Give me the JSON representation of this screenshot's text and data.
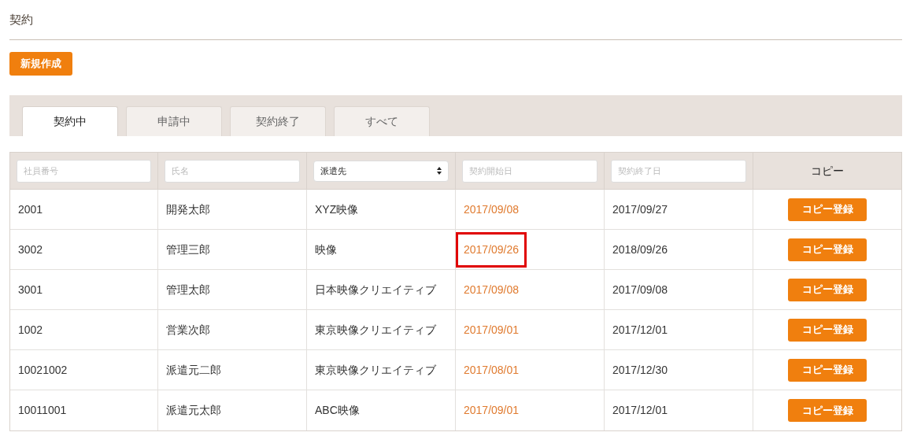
{
  "page_title": "契約",
  "new_button": "新規作成",
  "tabs": [
    {
      "label": "契約中",
      "selected": true
    },
    {
      "label": "申請中",
      "selected": false
    },
    {
      "label": "契約終了",
      "selected": false
    },
    {
      "label": "すべて",
      "selected": false
    }
  ],
  "filters": [
    {
      "kind": "input",
      "placeholder": "社員番号"
    },
    {
      "kind": "input",
      "placeholder": "氏名"
    },
    {
      "kind": "select",
      "value": "派遣先"
    },
    {
      "kind": "input",
      "placeholder": "契約開始日"
    },
    {
      "kind": "input",
      "placeholder": "契約終了日"
    },
    {
      "kind": "heading",
      "label": "コピー"
    }
  ],
  "rows": [
    {
      "id": "2001",
      "name": "開発太郎",
      "client": "XYZ映像",
      "start": "2017/09/08",
      "end": "2017/09/27",
      "action": "コピー登録",
      "highlighted": false
    },
    {
      "id": "3002",
      "name": "管理三郎",
      "client": "映像",
      "start": "2017/09/26",
      "end": "2018/09/26",
      "action": "コピー登録",
      "highlighted": true
    },
    {
      "id": "3001",
      "name": "管理太郎",
      "client": "日本映像クリエイティブ",
      "start": "2017/09/08",
      "end": "2017/09/08",
      "action": "コピー登録",
      "highlighted": false
    },
    {
      "id": "1002",
      "name": "営業次郎",
      "client": "東京映像クリエイティブ",
      "start": "2017/09/01",
      "end": "2017/12/01",
      "action": "コピー登録",
      "highlighted": false
    },
    {
      "id": "10021002",
      "name": "派遣元二郎",
      "client": "東京映像クリエイティブ",
      "start": "2017/08/01",
      "end": "2017/12/30",
      "action": "コピー登録",
      "highlighted": false
    },
    {
      "id": "10011001",
      "name": "派遣元太郎",
      "client": "ABC映像",
      "start": "2017/09/01",
      "end": "2017/12/01",
      "action": "コピー登録",
      "highlighted": false
    }
  ]
}
